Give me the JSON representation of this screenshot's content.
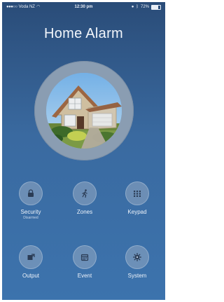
{
  "status_bar": {
    "carrier": "Voda NZ",
    "time": "12:30 pm",
    "battery": "72%"
  },
  "app": {
    "title": "Home Alarm"
  },
  "menu": {
    "items": [
      {
        "label": "Security",
        "sublabel": "Disarmed",
        "icon": "lock-icon"
      },
      {
        "label": "Zones",
        "sublabel": "",
        "icon": "running-person-icon"
      },
      {
        "label": "Keypad",
        "sublabel": "",
        "icon": "keypad-grid-icon"
      },
      {
        "label": "Output",
        "sublabel": "",
        "icon": "output-icon"
      },
      {
        "label": "Event",
        "sublabel": "",
        "icon": "calendar-icon"
      },
      {
        "label": "System",
        "sublabel": "",
        "icon": "gear-icon"
      }
    ]
  }
}
